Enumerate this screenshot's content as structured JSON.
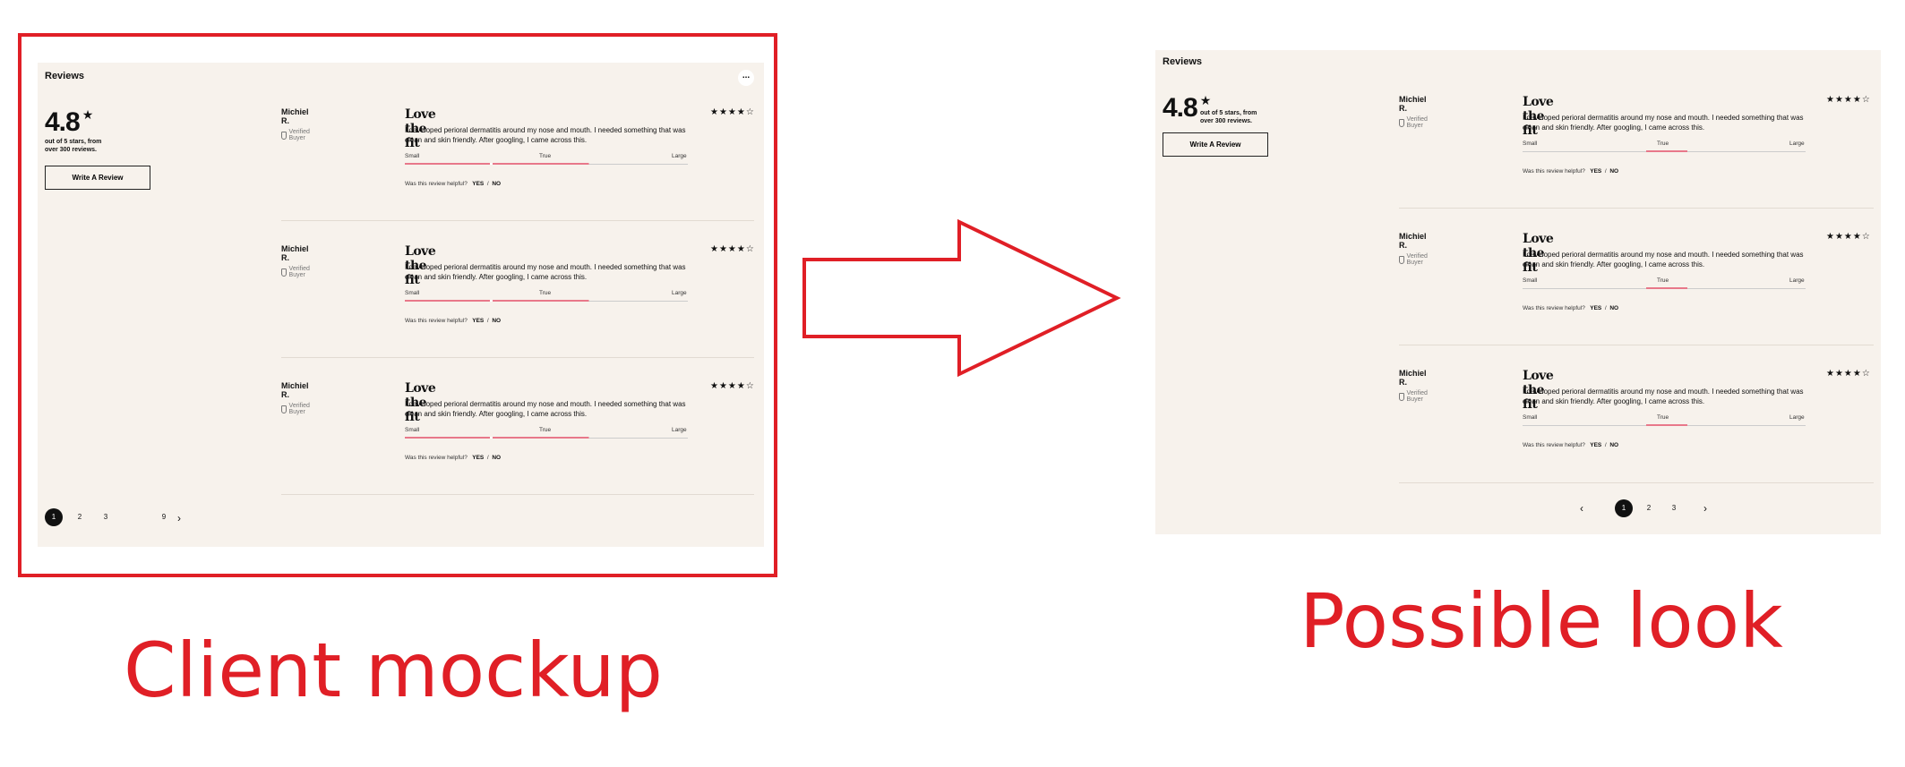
{
  "reviews_heading": "Reviews",
  "more_button": "...",
  "summary": {
    "score": "4.8",
    "star": "★",
    "subtitle": "out of 5 stars, from over 300 reviews.",
    "write_button": "Write A Review"
  },
  "review": {
    "name": "Michiel R.",
    "verified": "Verified Buyer",
    "title": "Love the fit",
    "body": "I developed perioral dermatitis around my nose and mouth. I needed something that was clean and skin friendly. After googling, I came across this.",
    "fit_small": "Small",
    "fit_true": "True",
    "fit_large": "Large",
    "helpful_q": "Was this review helpful?",
    "yes": "YES",
    "slash": "/",
    "no": "NO",
    "stars": "★★★★☆"
  },
  "pagination_left": {
    "pages": [
      "1",
      "2",
      "3",
      "9"
    ],
    "next": "›"
  },
  "pagination_right": {
    "prev": "‹",
    "pages": [
      "1",
      "2",
      "3"
    ],
    "next": "›"
  },
  "captions": {
    "left": "Client mockup",
    "right": "Possible look"
  },
  "colors": {
    "accent_red": "#e01f26",
    "panel_bg": "#f7f2ec",
    "fit_marker": "#e8788a"
  }
}
